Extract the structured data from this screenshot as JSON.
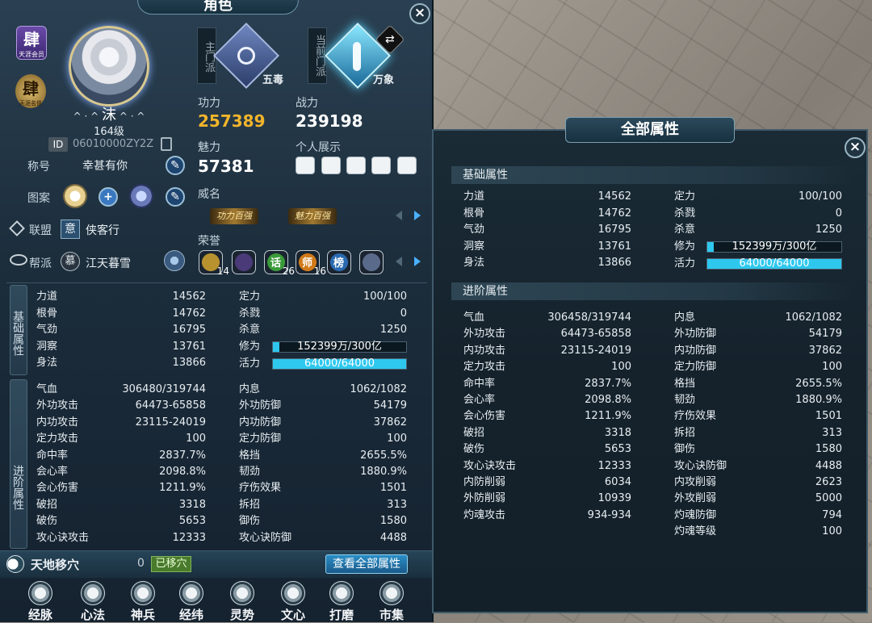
{
  "window": {
    "title": "角色"
  },
  "character": {
    "name": "沫",
    "name_decor_left": "^ · ^",
    "name_decor_right": "^ · ^",
    "level": "164级",
    "id_label": "ID",
    "id_value": "06010000ZY2Z",
    "badge_glyph": "肆",
    "badge_sub": "天涯会员",
    "badge2_sub": "天涯名俠",
    "title_label": "称号",
    "title_value": "幸甚有你",
    "pattern_label": "图案",
    "alliance_label": "联盟",
    "alliance_glyph": "意",
    "alliance_value": "侠客行",
    "guild_label": "帮派",
    "guild_glyph": "慕",
    "guild_value": "江天暮雪"
  },
  "sect": {
    "main_label": "主门派",
    "main_value": "五毒",
    "current_label": "当前门派",
    "current_value": "万象"
  },
  "power": {
    "gongli_label": "功力",
    "gongli_value": "257389",
    "zhanli_label": "战力",
    "zhanli_value": "239198",
    "meili_label": "魅力",
    "meili_value": "57381",
    "display_label": "个人展示",
    "weiming_label": "威名",
    "emblem1": "功力百强",
    "emblem2": "魅力百强",
    "rongyu_label": "荣誉",
    "honors": [
      {
        "icon": "honor-badge-1",
        "count": "14",
        "color": "#b8922e"
      },
      {
        "icon": "honor-badge-2",
        "count": "",
        "color": "#4a3a78"
      },
      {
        "icon": "honor-badge-3",
        "glyph": "话",
        "count": "26",
        "color": "#3a9a3a"
      },
      {
        "icon": "honor-badge-4",
        "glyph": "师",
        "count": "16",
        "color": "#d07a1a"
      },
      {
        "icon": "honor-badge-5",
        "glyph": "榜",
        "count": "",
        "color": "#2a6ab0"
      },
      {
        "icon": "honor-badge-6",
        "count": "",
        "color": "#5a6a8a"
      }
    ]
  },
  "sections": {
    "basic": "基础属性",
    "advanced": "进阶属性"
  },
  "basic_left": [
    {
      "name": "力道",
      "value": "14562"
    },
    {
      "name": "根骨",
      "value": "14762"
    },
    {
      "name": "气劲",
      "value": "16795"
    },
    {
      "name": "洞察",
      "value": "13761"
    },
    {
      "name": "身法",
      "value": "13866"
    }
  ],
  "basic_right": [
    {
      "name": "定力",
      "value": "100/100"
    },
    {
      "name": "杀戮",
      "value": "0"
    },
    {
      "name": "杀意",
      "value": "1250"
    }
  ],
  "xiuwei": {
    "name": "修为",
    "text": "152399万/300亿",
    "fraction": 0.05
  },
  "huoli": {
    "name": "活力",
    "text": "64000/64000",
    "fraction": 1.0
  },
  "adv_left": [
    {
      "name": "气血",
      "value": "306480/319744"
    },
    {
      "name": "外功攻击",
      "value": "64473-65858"
    },
    {
      "name": "内功攻击",
      "value": "23115-24019"
    },
    {
      "name": "定力攻击",
      "value": "100"
    },
    {
      "name": "命中率",
      "value": "2837.7%"
    },
    {
      "name": "会心率",
      "value": "2098.8%"
    },
    {
      "name": "会心伤害",
      "value": "1211.9%"
    },
    {
      "name": "破招",
      "value": "3318"
    },
    {
      "name": "破伤",
      "value": "5653"
    },
    {
      "name": "攻心诀攻击",
      "value": "12333"
    }
  ],
  "adv_right": [
    {
      "name": "内息",
      "value": "1062/1082"
    },
    {
      "name": "外功防御",
      "value": "54179"
    },
    {
      "name": "内功防御",
      "value": "37862"
    },
    {
      "name": "定力防御",
      "value": "100"
    },
    {
      "name": "格挡",
      "value": "2655.5%"
    },
    {
      "name": "韧劲",
      "value": "1880.9%"
    },
    {
      "name": "疗伤效果",
      "value": "1501"
    },
    {
      "name": "拆招",
      "value": "313"
    },
    {
      "name": "御伤",
      "value": "1580"
    },
    {
      "name": "攻心诀防御",
      "value": "4488"
    }
  ],
  "footer": {
    "tiandi_label": "天地移穴",
    "tiandi_count": "0",
    "tiandi_status": "已移穴",
    "view_all": "查看全部属性"
  },
  "nav": [
    {
      "label": "经脉",
      "icon": "meridian-icon"
    },
    {
      "label": "心法",
      "icon": "scroll-icon"
    },
    {
      "label": "神兵",
      "icon": "weapon-icon"
    },
    {
      "label": "经纬",
      "icon": "grid-icon"
    },
    {
      "label": "灵势",
      "icon": "spirit-icon"
    },
    {
      "label": "文心",
      "icon": "brush-icon"
    },
    {
      "label": "打磨",
      "icon": "hammer-icon"
    },
    {
      "label": "市集",
      "icon": "market-icon"
    }
  ],
  "all_attrs": {
    "title": "全部属性",
    "basic_header": "基础属性",
    "advanced_header": "进阶属性",
    "basic_left": [
      {
        "name": "力道",
        "value": "14562"
      },
      {
        "name": "根骨",
        "value": "14762"
      },
      {
        "name": "气劲",
        "value": "16795"
      },
      {
        "name": "洞察",
        "value": "13761"
      },
      {
        "name": "身法",
        "value": "13866"
      }
    ],
    "basic_right": [
      {
        "name": "定力",
        "value": "100/100"
      },
      {
        "name": "杀戮",
        "value": "0"
      },
      {
        "name": "杀意",
        "value": "1250"
      }
    ],
    "xiuwei": {
      "name": "修为",
      "text": "152399万/300亿",
      "fraction": 0.05
    },
    "huoli": {
      "name": "活力",
      "text": "64000/64000",
      "fraction": 1.0
    },
    "adv_left": [
      {
        "name": "气血",
        "value": "306458/319744"
      },
      {
        "name": "外功攻击",
        "value": "64473-65858"
      },
      {
        "name": "内功攻击",
        "value": "23115-24019"
      },
      {
        "name": "定力攻击",
        "value": "100"
      },
      {
        "name": "命中率",
        "value": "2837.7%"
      },
      {
        "name": "会心率",
        "value": "2098.8%"
      },
      {
        "name": "会心伤害",
        "value": "1211.9%"
      },
      {
        "name": "破招",
        "value": "3318"
      },
      {
        "name": "破伤",
        "value": "5653"
      },
      {
        "name": "攻心诀攻击",
        "value": "12333"
      },
      {
        "name": "内防削弱",
        "value": "6034"
      },
      {
        "name": "外防削弱",
        "value": "10939"
      },
      {
        "name": "灼魂攻击",
        "value": "934-934"
      }
    ],
    "adv_right": [
      {
        "name": "内息",
        "value": "1062/1082"
      },
      {
        "name": "外功防御",
        "value": "54179"
      },
      {
        "name": "内功防御",
        "value": "37862"
      },
      {
        "name": "定力防御",
        "value": "100"
      },
      {
        "name": "格挡",
        "value": "2655.5%"
      },
      {
        "name": "韧劲",
        "value": "1880.9%"
      },
      {
        "name": "疗伤效果",
        "value": "1501"
      },
      {
        "name": "拆招",
        "value": "313"
      },
      {
        "name": "御伤",
        "value": "1580"
      },
      {
        "name": "攻心诀防御",
        "value": "4488"
      },
      {
        "name": "内攻削弱",
        "value": "2623"
      },
      {
        "name": "外攻削弱",
        "value": "5000"
      },
      {
        "name": "灼魂防御",
        "value": "794"
      },
      {
        "name": "灼魂等级",
        "value": "100"
      }
    ]
  },
  "colors": {
    "gongli": "#f2b52a",
    "bar": "#2ec8ef"
  }
}
